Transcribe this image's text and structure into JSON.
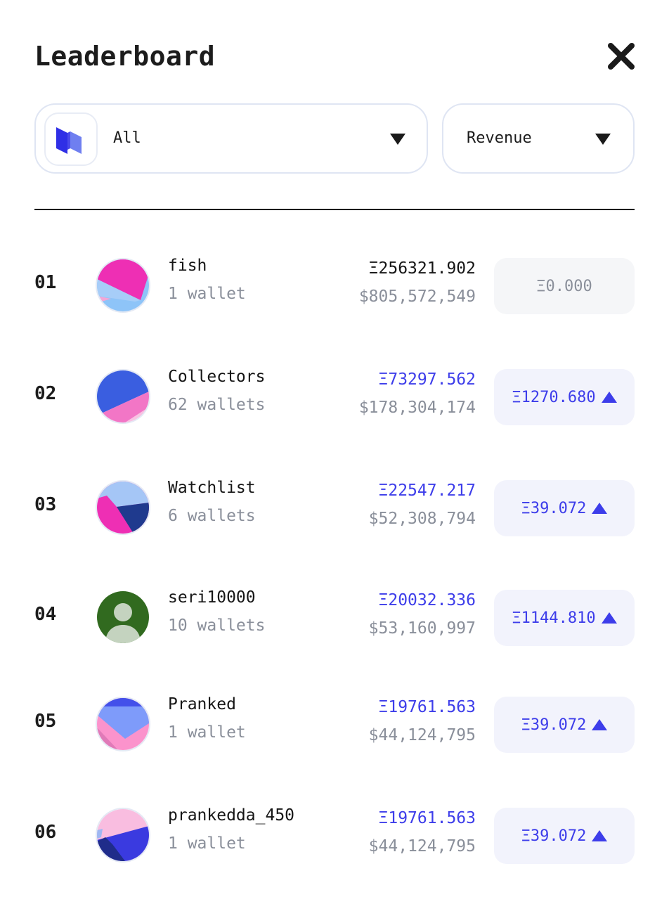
{
  "header": {
    "title": "Leaderboard"
  },
  "filters": {
    "collection": {
      "selected": "All"
    },
    "metric": {
      "selected": "Revenue"
    }
  },
  "colors": {
    "accent": "#3d3dea",
    "muted": "#8a8f9a",
    "neutral_pill": "#f5f6f8",
    "accent_pill": "#f2f3fc",
    "divider": "#1a1a1a"
  },
  "rows": [
    {
      "rank": "01",
      "name": "fish",
      "wallets": "1 wallet",
      "eth": "Ξ256321.902",
      "usd": "$805,572,549",
      "change": "Ξ0.000",
      "change_direction": "none",
      "highlight": false
    },
    {
      "rank": "02",
      "name": "Collectors",
      "wallets": "62 wallets",
      "eth": "Ξ73297.562",
      "usd": "$178,304,174",
      "change": "Ξ1270.680",
      "change_direction": "up",
      "highlight": true
    },
    {
      "rank": "03",
      "name": "Watchlist",
      "wallets": "6 wallets",
      "eth": "Ξ22547.217",
      "usd": "$52,308,794",
      "change": "Ξ39.072",
      "change_direction": "up",
      "highlight": true
    },
    {
      "rank": "04",
      "name": "seri10000",
      "wallets": "10 wallets",
      "eth": "Ξ20032.336",
      "usd": "$53,160,997",
      "change": "Ξ1144.810",
      "change_direction": "up",
      "highlight": true
    },
    {
      "rank": "05",
      "name": "Pranked",
      "wallets": "1 wallet",
      "eth": "Ξ19761.563",
      "usd": "$44,124,795",
      "change": "Ξ39.072",
      "change_direction": "up",
      "highlight": true
    },
    {
      "rank": "06",
      "name": "prankedda_450",
      "wallets": "1 wallet",
      "eth": "Ξ19761.563",
      "usd": "$44,124,795",
      "change": "Ξ39.072",
      "change_direction": "up",
      "highlight": true
    }
  ],
  "icons": {
    "close": "close-icon",
    "caret": "caret-down-icon",
    "logo": "collection-logo-icon",
    "trend": "triangle-up-icon",
    "default_avatar": "user-silhouette-icon"
  }
}
